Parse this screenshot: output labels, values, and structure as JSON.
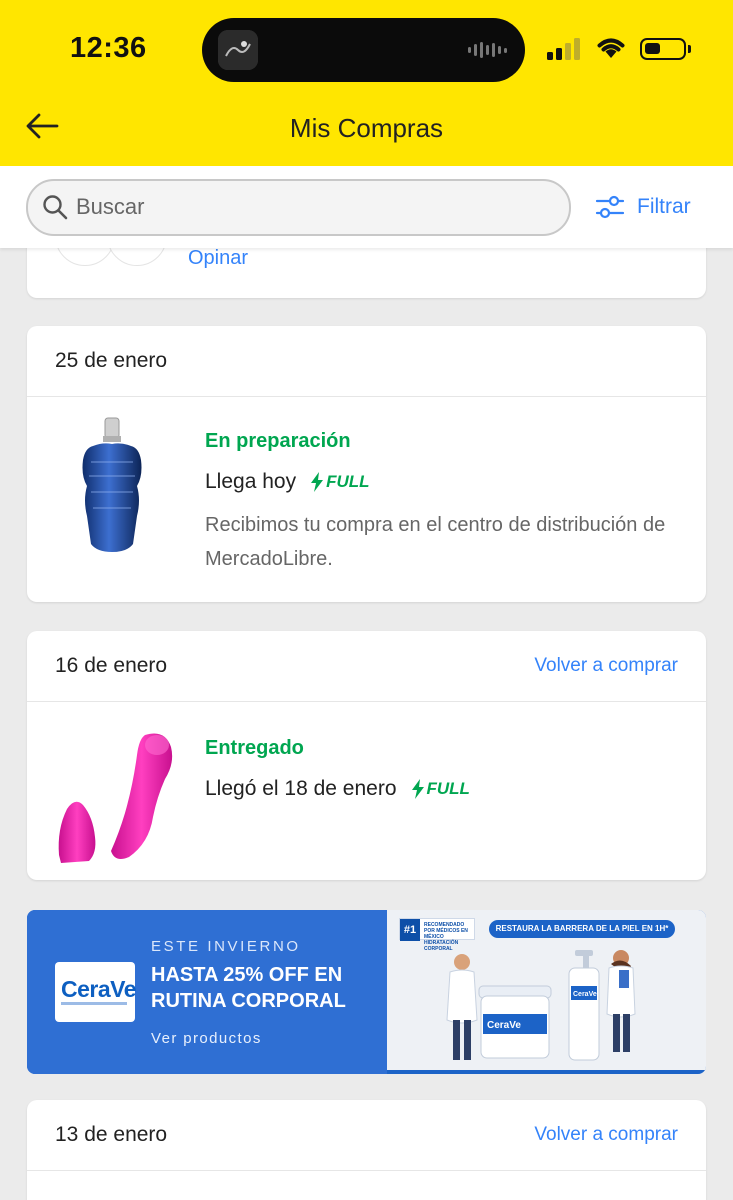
{
  "status_bar": {
    "time": "12:36"
  },
  "header": {
    "title": "Mis Compras"
  },
  "search": {
    "placeholder": "Buscar",
    "filter_label": "Filtrar"
  },
  "partial_card": {
    "action": "Opinar"
  },
  "orders": [
    {
      "date": "25 de enero",
      "status": "En preparación",
      "delivery": "Llega hoy",
      "badge": "FULL",
      "description": "Recibimos tu compra en el centro de distribución de MercadoLibre.",
      "product_icon": "perfume-bottle-icon"
    },
    {
      "date": "16 de enero",
      "action": "Volver a comprar",
      "status": "Entregado",
      "delivery": "Llegó el 18 de enero",
      "badge": "FULL",
      "product_icon": "pink-product-icon"
    },
    {
      "date": "13 de enero",
      "action": "Volver a comprar"
    }
  ],
  "banner": {
    "brand": "CeraVe",
    "eyebrow": "ESTE INVIERNO",
    "title": "HASTA 25% OFF EN RUTINA CORPORAL",
    "cta": "Ver productos",
    "rank": "#1",
    "rank_text": "RECOMENDADO POR MÉDICOS EN MÉXICO HIDRATACIÓN CORPORAL",
    "pill": "RESTAURA LA BARRERA DE LA PIEL EN 1H*"
  },
  "colors": {
    "brand_yellow": "#ffe600",
    "link_blue": "#3483fa",
    "success_green": "#00a650",
    "banner_blue": "#2f6fd3"
  }
}
